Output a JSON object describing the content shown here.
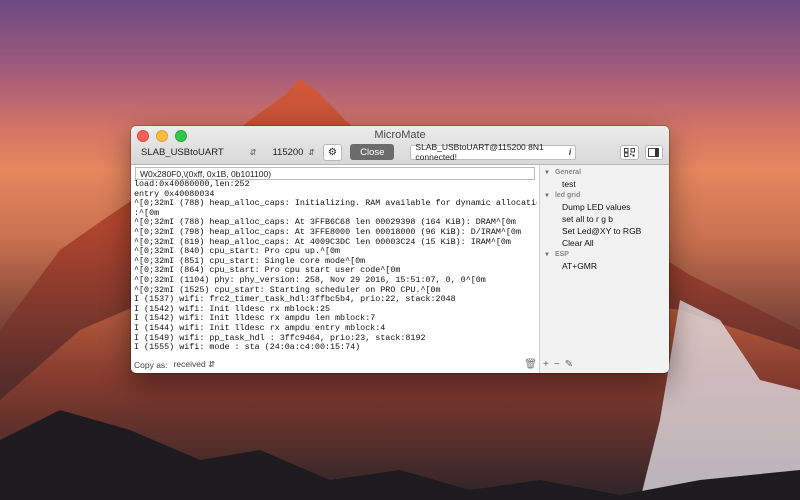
{
  "window": {
    "title": "MicroMate"
  },
  "toolbar": {
    "port": "SLAB_USBtoUART",
    "baud": "115200",
    "close_label": "Close",
    "status": "SLAB_USBtoUART@115200 8N1 connected!"
  },
  "console": {
    "input_value": "W0x280F0,\\(0xff, 0x1B, 0b101100)",
    "lines": [
      "load:0x40080000,len:252",
      "entry 0x40080034",
      "^[0;32mI (788) heap_alloc_caps: Initializing. RAM available for dynamic allocation",
      ":^[0m",
      "^[0;32mI (788) heap_alloc_caps: At 3FFB6C68 len 00029398 (164 KiB): DRAM^[0m",
      "^[0;32mI (798) heap_alloc_caps: At 3FFE8000 len 00018000 (96 KiB): D/IRAM^[0m",
      "^[0;32mI (819) heap_alloc_caps: At 4009C3DC len 00003C24 (15 KiB): IRAM^[0m",
      "^[0;32mI (840) cpu_start: Pro cpu up.^[0m",
      "^[0;32mI (851) cpu_start: Single core mode^[0m",
      "^[0;32mI (864) cpu_start: Pro cpu start user code^[0m",
      "^[0;32mI (1104) phy: phy_version: 258, Nov 29 2016, 15:51:07, 0, 0^[0m",
      "^[0;32mI (1525) cpu_start: Starting scheduler on PRO CPU.^[0m",
      "I (1537) wifi: frc2_timer_task_hdl:3ffbc5b4, prio:22, stack:2048",
      "I (1542) wifi: Init lldesc rx mblock:25",
      "I (1542) wifi: Init lldesc rx ampdu len mblock:7",
      "I (1544) wifi: Init lldesc rx ampdu entry mblock:4",
      "I (1549) wifi: pp_task_hdl : 3ffc9464, prio:23, stack:8192",
      "I (1555) wifi: mode : sta (24:0a:c4:00:15:74)"
    ]
  },
  "bottom": {
    "copy_label": "Copy as:",
    "copy_value": "received"
  },
  "sidebar": {
    "groups": [
      {
        "name": "General",
        "items": [
          "test"
        ]
      },
      {
        "name": "led grid",
        "items": [
          "Dump LED values",
          "set all to r g b",
          "Set Led@XY to RGB",
          "Clear All"
        ]
      },
      {
        "name": "ESP",
        "items": [
          "AT+GMR"
        ]
      }
    ],
    "footer": {
      "add": "+",
      "remove": "−"
    }
  }
}
